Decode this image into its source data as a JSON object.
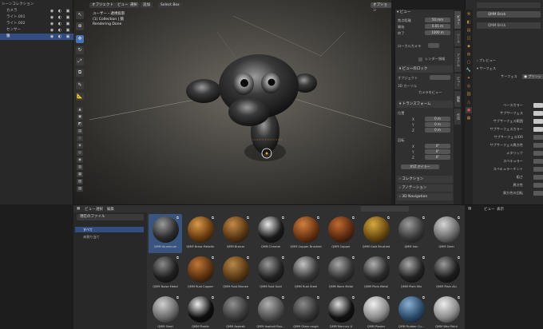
{
  "outliner": {
    "items": [
      {
        "label": "シーンコレクション",
        "indent": 0
      },
      {
        "label": "カメラ",
        "indent": 1
      },
      {
        "label": "ライト.001",
        "indent": 1
      },
      {
        "label": "ライト.002",
        "indent": 1
      },
      {
        "label": "センサー",
        "indent": 1
      },
      {
        "label": "猿",
        "indent": 1,
        "selected": true
      }
    ]
  },
  "viewport": {
    "mode": "オブジェクト",
    "menus": [
      "ビュー",
      "選択",
      "追加",
      "オブジェクト"
    ],
    "shading_dropdown": "Select Box",
    "info_line1": "ユーザー・透視投影",
    "info_line2": "(1) Collection | 猿",
    "info_line3": "Rendering Done",
    "options_label": "オプション"
  },
  "npanel": {
    "view_header": "ビュー",
    "rows": [
      {
        "label": "焦点距離",
        "value": "50 mm"
      },
      {
        "label": "開始",
        "value": "0.01 m"
      },
      {
        "label": "終了",
        "value": "1000 m"
      }
    ],
    "local_camera": "ローカルカメラ",
    "render_region": "レンダー領域",
    "view_lock_header": "ビューのロック",
    "lock_object": "オブジェクト",
    "cursor_label": "3D カーソル",
    "camera_to_view": "カメラをビュー",
    "transform_header": "トランスフォーム",
    "location_label": "位置",
    "loc": [
      {
        "axis": "X",
        "value": "0 m"
      },
      {
        "axis": "Y",
        "value": "0 m"
      },
      {
        "axis": "Z",
        "value": "0 m"
      }
    ],
    "rotation_label": "回転",
    "rot": [
      {
        "axis": "X",
        "value": "0°"
      },
      {
        "axis": "Y",
        "value": "0°"
      },
      {
        "axis": "Z",
        "value": "0°"
      }
    ],
    "xyz_euler": "XYZ オイラー",
    "sub_collection": "コレクション",
    "sub_annotation": "アノテーション",
    "sub_navigation": "3D Navigation",
    "tabs": [
      "ビュー",
      "ツール",
      "アイテム",
      "ビュー",
      "編集",
      "作成"
    ]
  },
  "properties": {
    "material_name": "QMM Brick",
    "slot_label": "QMM Brick",
    "preview": "プレビュー",
    "surface": "サーフェス",
    "surface_type": "サーフェス",
    "principled": "プリンシ",
    "rows": [
      "ベースカラー",
      "サブサーフェス",
      "サブサーフェス範囲",
      "サブサーフェスカラー",
      "サブサーフェスIOR",
      "サブサーフェス異方性",
      "メタリック",
      "スペキュラー",
      "スペキュラーチント",
      "粗さ",
      "異方性",
      "異方性の回転"
    ]
  },
  "asset_browser": {
    "menus": [
      "ビュー",
      "選択",
      "編集"
    ],
    "library": "現在のファイル",
    "categories": [
      {
        "label": "すべて",
        "selected": true
      },
      {
        "label": "未割り当て",
        "selected": false
      }
    ],
    "tiles": [
      {
        "label": "QMM Aluminum",
        "color": "#2a2a2a",
        "hi": "#9a9a9a"
      },
      {
        "label": "QMM Brass Metallic",
        "color": "#6a3c10",
        "hi": "#d89a4a"
      },
      {
        "label": "QMM Bronze",
        "color": "#5a3815",
        "hi": "#c58a45"
      },
      {
        "label": "QMM Chrome",
        "color": "#1a1a1a",
        "hi": "#e8e8e8"
      },
      {
        "label": "QMM Copper Brushed",
        "color": "#6a3412",
        "hi": "#d08040"
      },
      {
        "label": "QMM Copper",
        "color": "#5a2a10",
        "hi": "#c06a30"
      },
      {
        "label": "QMM Gold Brushed",
        "color": "#6a4a10",
        "hi": "#d8a840"
      },
      {
        "label": "QMM Iron",
        "color": "#3a3a3a",
        "hi": "#9c9c9c"
      },
      {
        "label": "QMM Steel",
        "color": "#6a6a6a",
        "hi": "#d6d6d6"
      },
      {
        "label": "QMM Noise Metal",
        "color": "#1e1e1e",
        "hi": "#8a8a8a"
      },
      {
        "label": "QMM Rust Copper",
        "color": "#5a3010",
        "hi": "#c07838"
      },
      {
        "label": "QMM Rust Bronze",
        "color": "#5a3a14",
        "hi": "#b88848"
      },
      {
        "label": "QMM Rust Gold",
        "color": "#222222",
        "hi": "#9a9a9a"
      },
      {
        "label": "QMM Rust Steel",
        "color": "#3a3a3a",
        "hi": "#c4c4c4"
      },
      {
        "label": "QMM Worn Metal",
        "color": "#333333",
        "hi": "#a8a8a8"
      },
      {
        "label": "QMM Plain Metal",
        "color": "#2a2a2a",
        "hi": "#b0b0b0"
      },
      {
        "label": "QMM Plain Mix",
        "color": "#222222",
        "hi": "#aaaaaa"
      },
      {
        "label": "QMM Plain Alu",
        "color": "#1c1c1c",
        "hi": "#9a9a9a"
      },
      {
        "label": "QMM Steel",
        "color": "#6a6a6a",
        "hi": "#d0d0d0"
      },
      {
        "label": "QMM Plastic",
        "color": "#0e0e0e",
        "hi": "#eeeeee"
      },
      {
        "label": "QMM Asphalt",
        "color": "#3a3a3a",
        "hi": "#909090"
      },
      {
        "label": "QMM Asphalt Rou...",
        "color": "#505050",
        "hi": "#b0b0b0"
      },
      {
        "label": "QMM Glass rough",
        "color": "#333333",
        "hi": "#8a8a8a"
      },
      {
        "label": "QMM Mercury U",
        "color": "#111111",
        "hi": "#dddddd"
      },
      {
        "label": "QMM Plaster",
        "color": "#8a8a8a",
        "hi": "#f0f0f0"
      },
      {
        "label": "QMM Rubber Cu...",
        "color": "#2a4a6a",
        "hi": "#8ab0d0"
      },
      {
        "label": "QMM Wax Paint",
        "color": "#8a8a8a",
        "hi": "#ececec"
      }
    ]
  },
  "bottom_right": {
    "menus": [
      "ビュー",
      "表示"
    ]
  }
}
